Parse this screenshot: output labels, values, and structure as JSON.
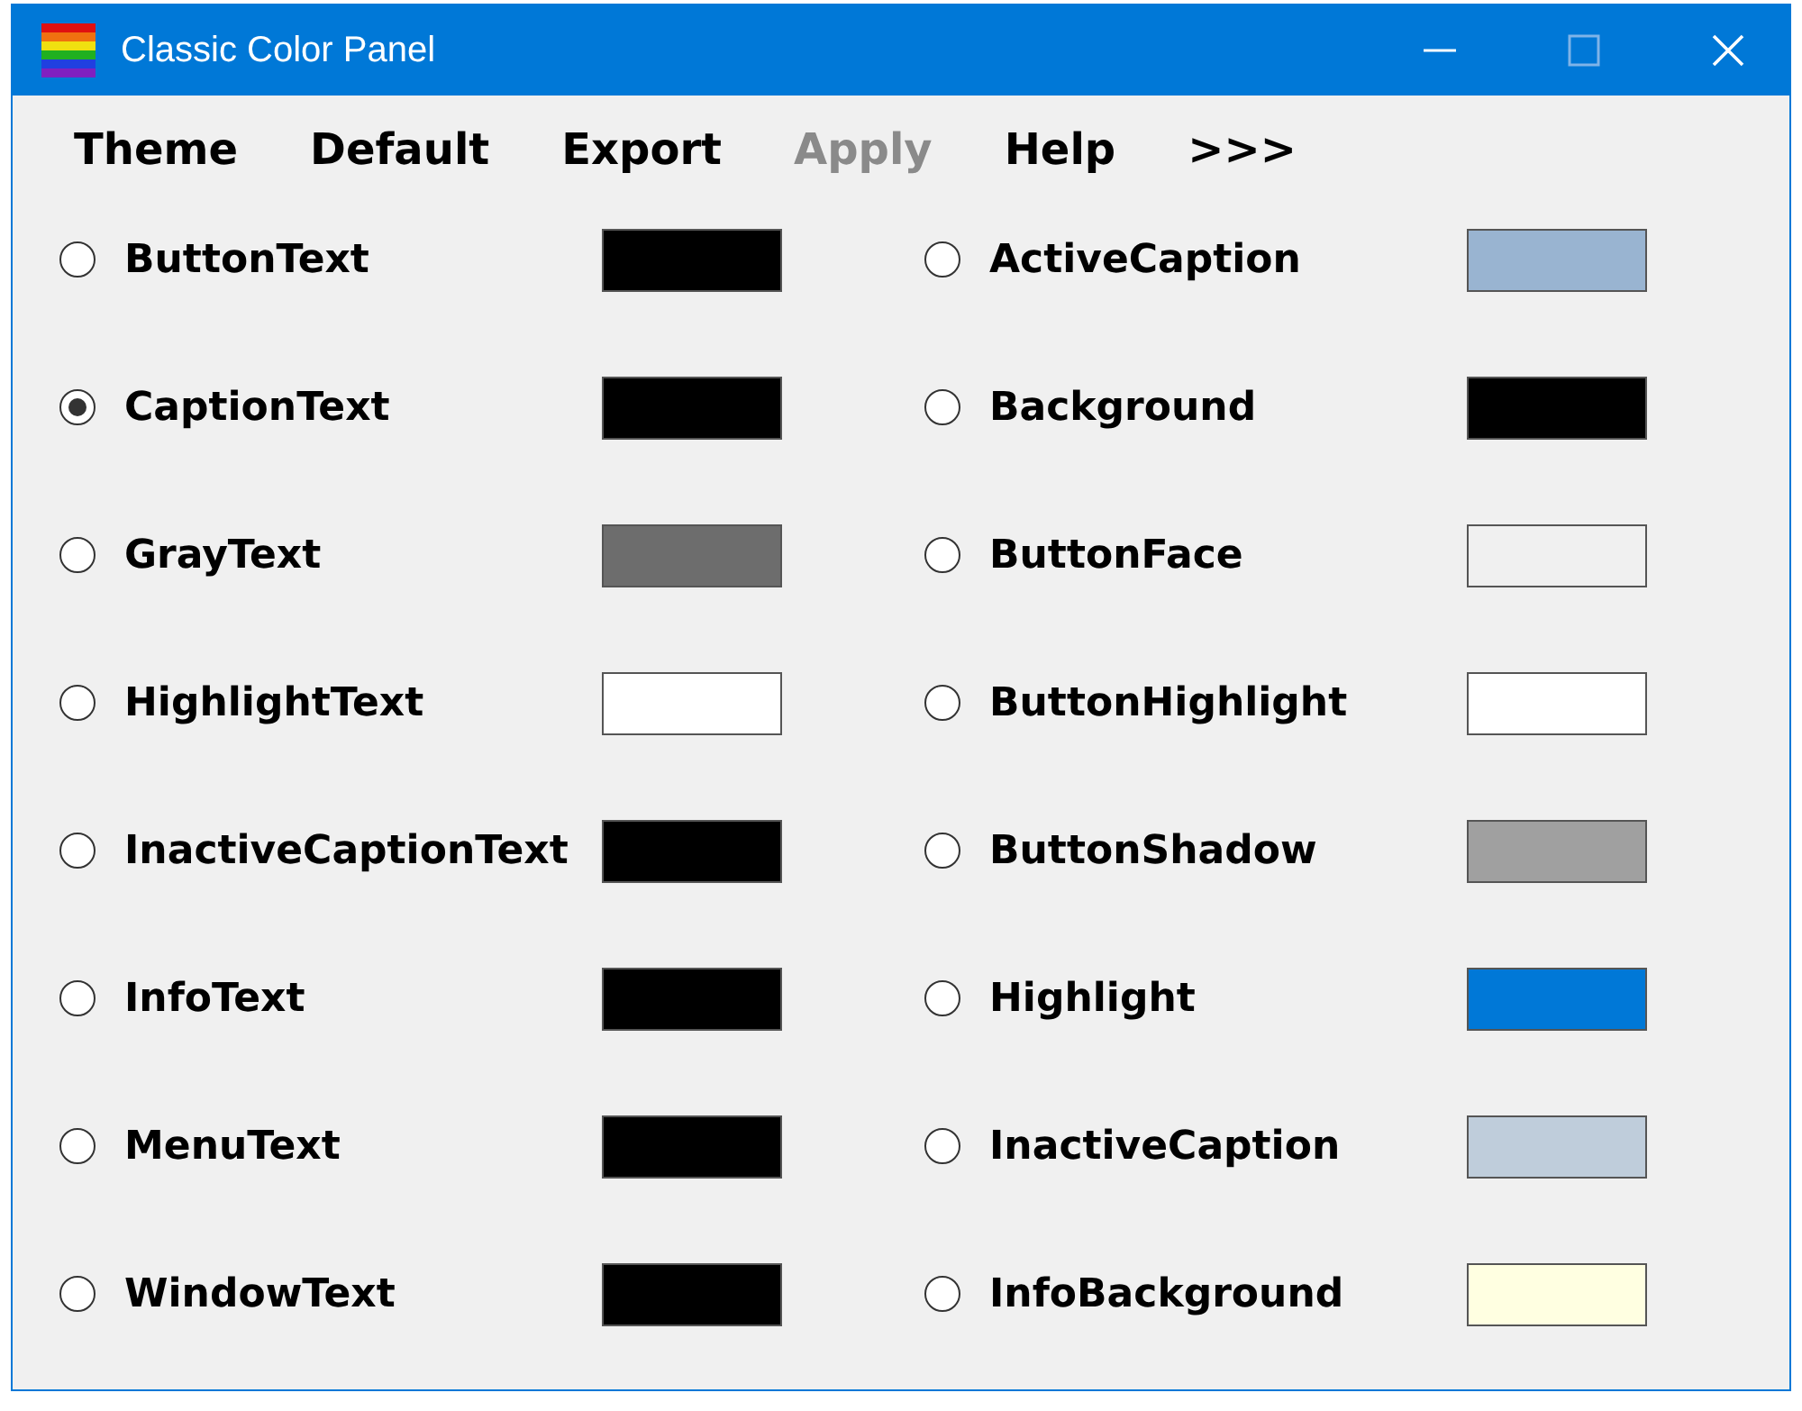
{
  "window": {
    "title": "Classic Color Panel"
  },
  "menu": [
    {
      "label": "Theme",
      "disabled": false
    },
    {
      "label": "Default",
      "disabled": false
    },
    {
      "label": "Export",
      "disabled": false
    },
    {
      "label": "Apply",
      "disabled": true
    },
    {
      "label": "Help",
      "disabled": false
    },
    {
      "label": ">>>",
      "disabled": false
    }
  ],
  "columns": [
    [
      {
        "name": "ButtonText",
        "selected": false,
        "color": "#000000"
      },
      {
        "name": "CaptionText",
        "selected": true,
        "color": "#000000"
      },
      {
        "name": "GrayText",
        "selected": false,
        "color": "#6d6d6d"
      },
      {
        "name": "HighlightText",
        "selected": false,
        "color": "#ffffff"
      },
      {
        "name": "InactiveCaptionText",
        "selected": false,
        "color": "#000000"
      },
      {
        "name": "InfoText",
        "selected": false,
        "color": "#000000"
      },
      {
        "name": "MenuText",
        "selected": false,
        "color": "#000000"
      },
      {
        "name": "WindowText",
        "selected": false,
        "color": "#000000"
      }
    ],
    [
      {
        "name": "ActiveCaption",
        "selected": false,
        "color": "#99b4d1"
      },
      {
        "name": "Background",
        "selected": false,
        "color": "#000000"
      },
      {
        "name": "ButtonFace",
        "selected": false,
        "color": "#f0f0f0"
      },
      {
        "name": "ButtonHighlight",
        "selected": false,
        "color": "#ffffff"
      },
      {
        "name": "ButtonShadow",
        "selected": false,
        "color": "#a0a0a0"
      },
      {
        "name": "Highlight",
        "selected": false,
        "color": "#0078d7"
      },
      {
        "name": "InactiveCaption",
        "selected": false,
        "color": "#bfcddb"
      },
      {
        "name": "InfoBackground",
        "selected": false,
        "color": "#ffffe1"
      }
    ]
  ]
}
